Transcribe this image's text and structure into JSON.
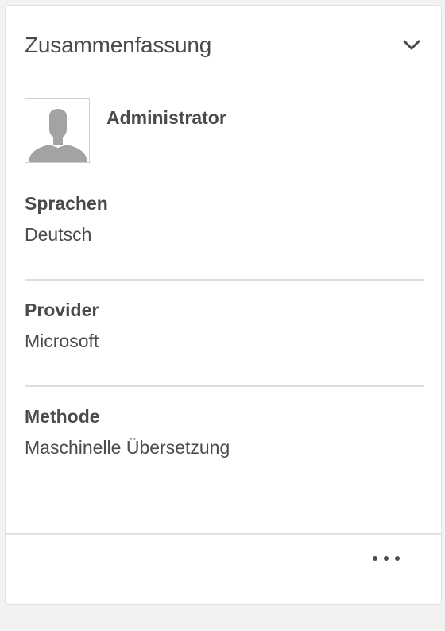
{
  "card": {
    "title": "Zusammenfassung"
  },
  "user": {
    "name": "Administrator"
  },
  "fields": [
    {
      "label": "Sprachen",
      "value": "Deutsch"
    },
    {
      "label": "Provider",
      "value": "Microsoft"
    },
    {
      "label": "Methode",
      "value": "Maschinelle Übersetzung"
    }
  ],
  "icons": {
    "collapse": "chevron-down-icon",
    "avatar": "user-silhouette-icon",
    "more": "more-horizontal-icon"
  },
  "colors": {
    "background": "#f2f2f2",
    "card": "#ffffff",
    "text": "#4b4b4b",
    "divider": "#dedede",
    "avatar": "#a3a3a3"
  }
}
